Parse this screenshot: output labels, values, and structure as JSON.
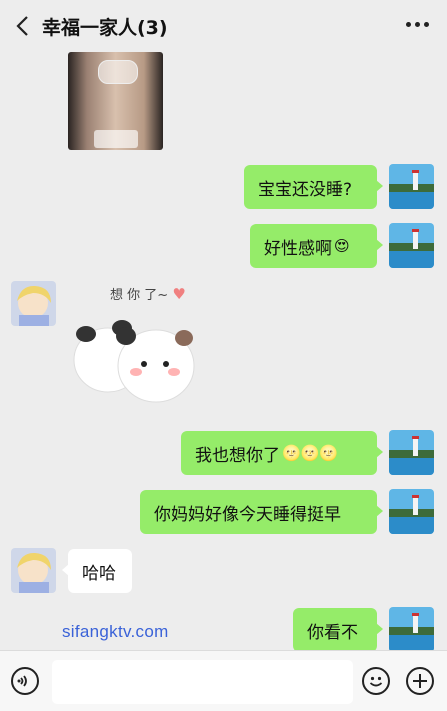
{
  "header": {
    "title": "幸福一家人(3)"
  },
  "messages": {
    "m1": "宝宝还没睡?",
    "m2": "好性感啊",
    "m2_emoji": "😍",
    "sticker_text": "想 你 了~",
    "m3": "我也想你了",
    "m3_emoji": "🌝🌝🌝",
    "m4": "你妈妈好像今天睡得挺早",
    "m5": "哈哈",
    "m6": "你看不"
  },
  "watermark": "sifangktv.com",
  "input": {
    "value": ""
  },
  "icons": {
    "back": "chevron-left-icon",
    "more": "more-dots-icon",
    "voice": "voice-icon",
    "emoji": "emoji-icon",
    "plus": "plus-icon"
  },
  "colors": {
    "bubble_self": "#95ec69",
    "bubble_other": "#ffffff",
    "background": "#ededed"
  }
}
